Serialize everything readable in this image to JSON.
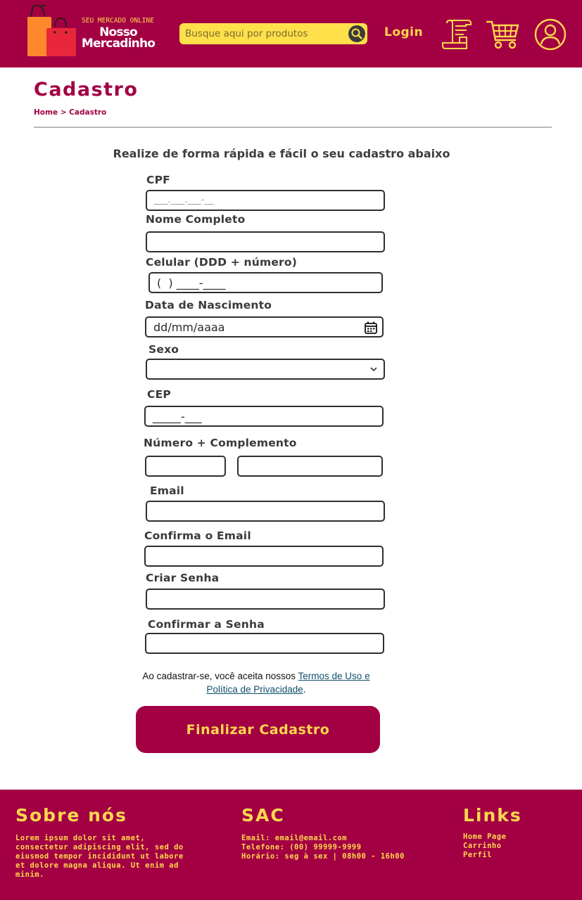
{
  "header": {
    "logo_sub": "SEU MERCADO ONLINE",
    "logo_line1": "Nosso",
    "logo_line2": "Mercadinho",
    "search_placeholder": "Busque aqui por produtos",
    "login_label": "Login",
    "icons": [
      "receipt-icon",
      "cart-icon",
      "user-icon"
    ],
    "colors": {
      "primary": "#a30044",
      "accent": "#ffd84d",
      "search_bg": "#ffe04a"
    }
  },
  "page": {
    "title": "Cadastro",
    "breadcrumb": "Home > Cadastro",
    "intro": "Realize de forma rápida e fácil o seu cadastro abaixo"
  },
  "form": {
    "cpf_label": "CPF",
    "cpf_mask": "___.___.___-__",
    "nome_label": "Nome Completo",
    "celular_label": "Celular (DDD + número)",
    "celular_mask": "(  ) ____-____",
    "nascimento_label": "Data de Nascimento",
    "nascimento_value": "dd/mm/aaaa",
    "sexo_label": "Sexo",
    "sexo_value": "",
    "cep_label": "CEP",
    "cep_mask": "_____-___",
    "numero_label": "Número + Complemento",
    "email_label": "Email",
    "confirma_email_label": "Confirma o Email",
    "senha_label": "Criar Senha",
    "confirma_senha_label": "Confirmar a Senha",
    "terms_prefix": "Ao cadastrar-se, você aceita nossos ",
    "terms_link": "Termos de Uso e Política de Privacidade",
    "terms_suffix": ".",
    "submit_label": "Finalizar Cadastro"
  },
  "footer": {
    "about_title": "Sobre nós",
    "about_text": "Lorem ipsum dolor sit amet, consectetur adipiscing elit, sed do eiusmod tempor incididunt ut labore et dolore magna aliqua. Ut enim ad minim.",
    "sac_title": "SAC",
    "sac_email": "Email: email@email.com",
    "sac_phone": "Telefone: (00) 99999-9999",
    "sac_hours": "Horário: seg à sex | 08h00 - 16h00",
    "links_title": "Links",
    "links": [
      "Home Page",
      "Carrinho",
      "Perfil"
    ]
  }
}
